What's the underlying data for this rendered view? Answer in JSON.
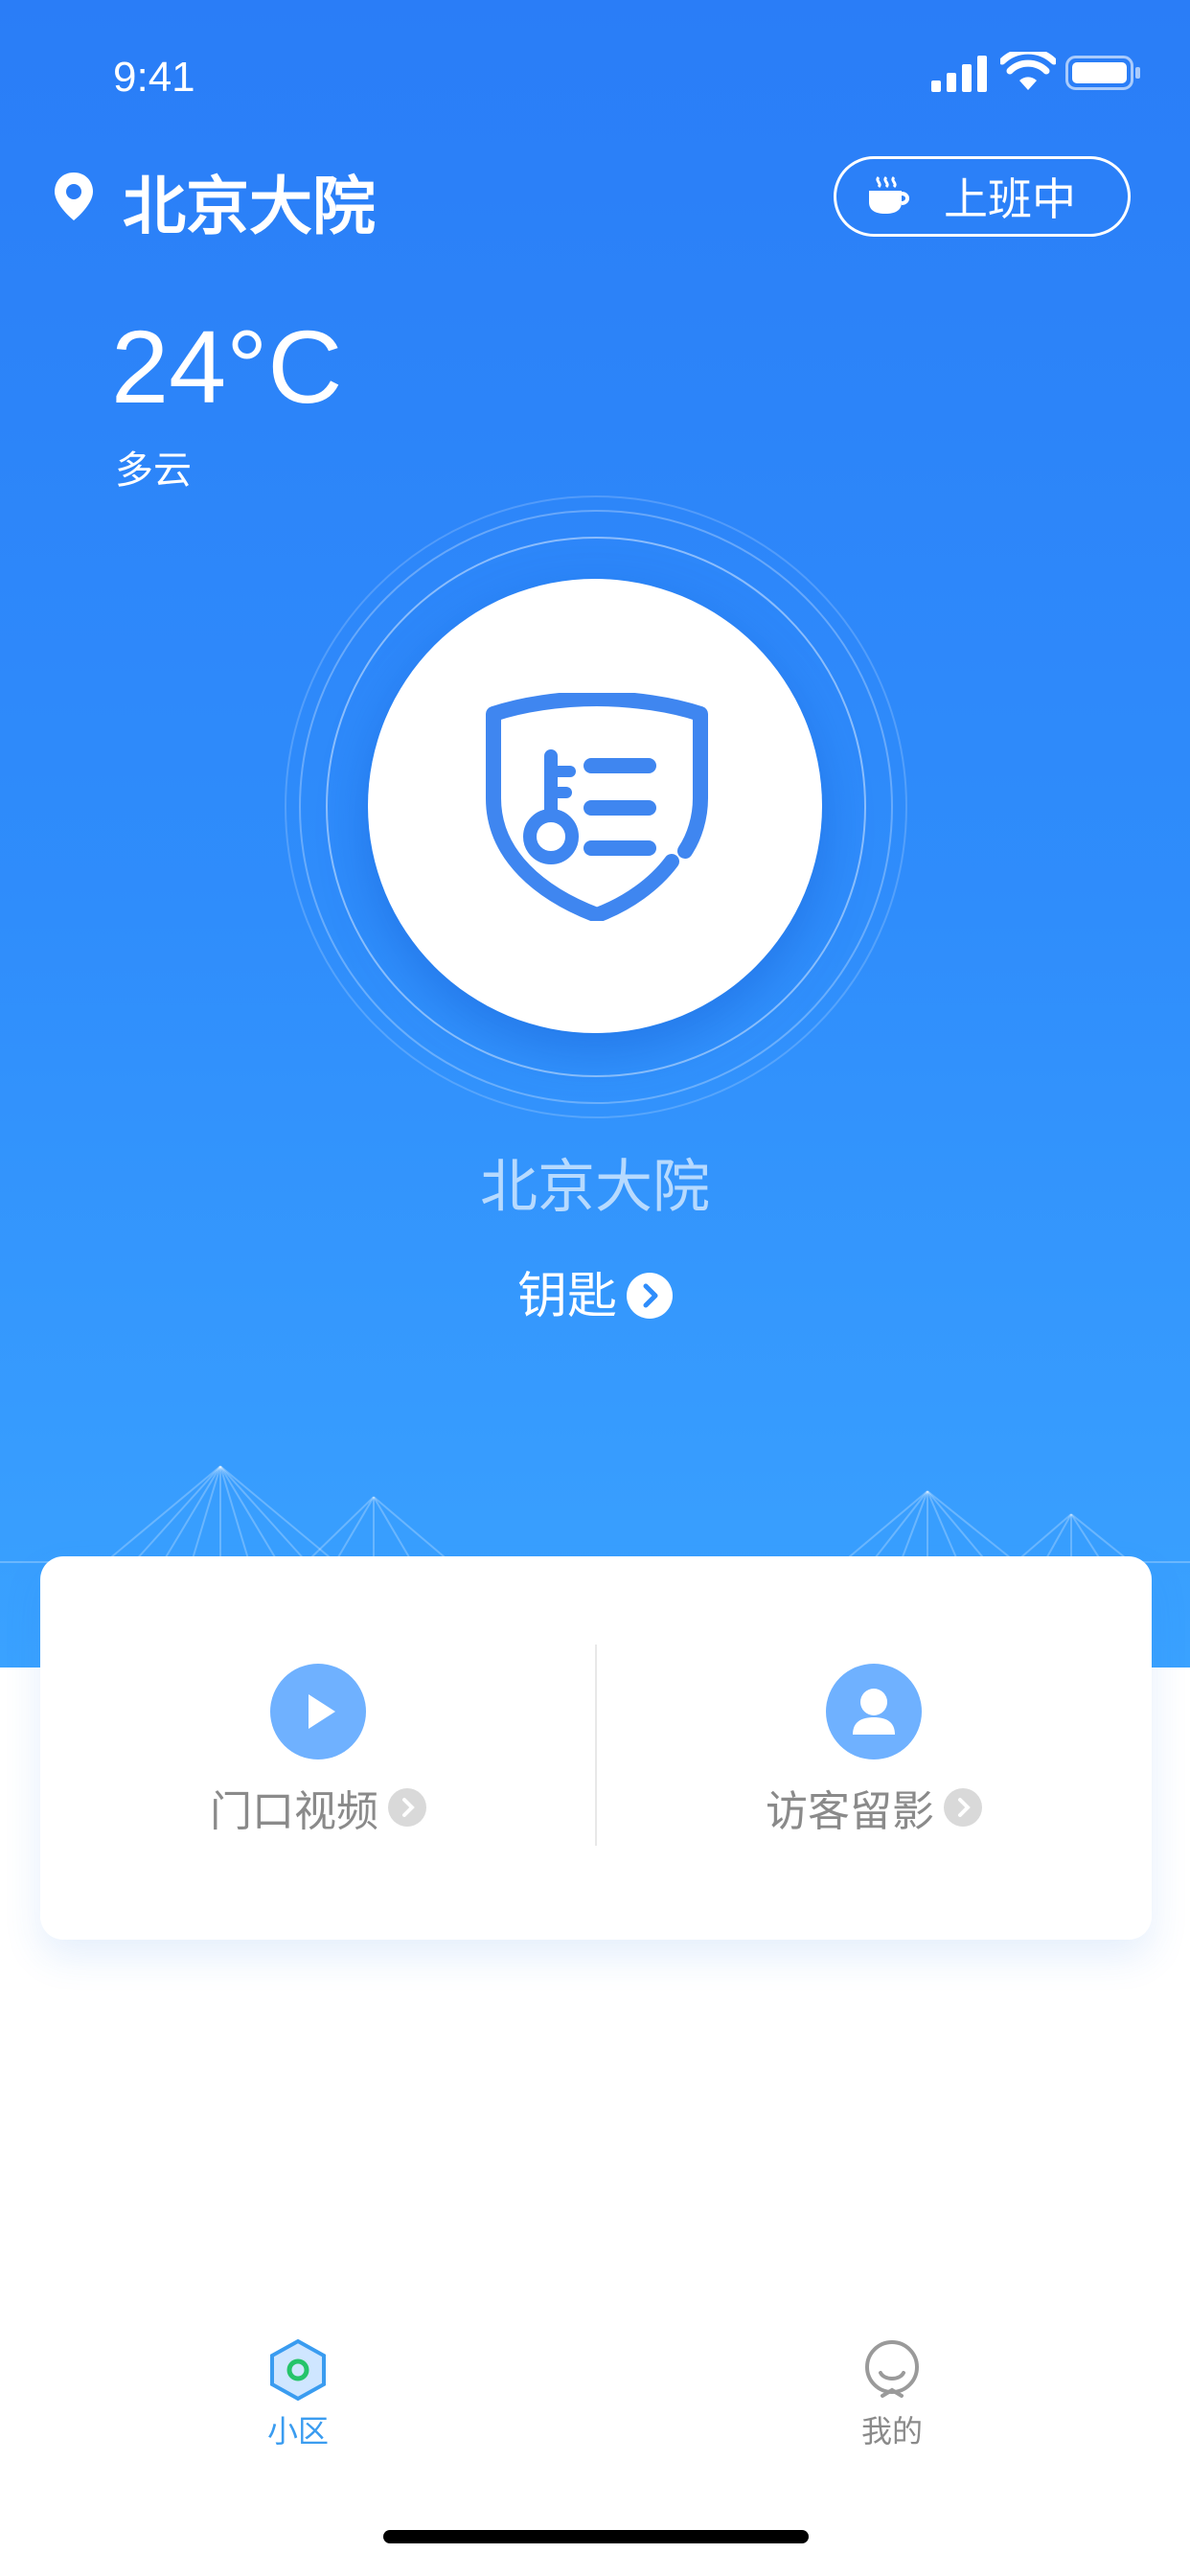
{
  "status_bar": {
    "time": "9:41"
  },
  "header": {
    "location": "北京大院",
    "duty_label": "上班中"
  },
  "weather": {
    "temperature": "24°C",
    "condition": "多云"
  },
  "main": {
    "place_name": "北京大院",
    "key_label": "钥匙"
  },
  "actions": [
    {
      "label": "门口视频",
      "icon": "play-icon"
    },
    {
      "label": "访客留影",
      "icon": "user-icon"
    }
  ],
  "tabbar": {
    "items": [
      {
        "label": "小区",
        "icon": "community-hex-icon",
        "active": true
      },
      {
        "label": "我的",
        "icon": "profile-icon",
        "active": false
      }
    ]
  },
  "colors": {
    "brand": "#2a7df7",
    "accent_light": "#6fb1ff",
    "tab_active": "#3a9cf0",
    "tab_inactive": "#8a8a8a"
  }
}
